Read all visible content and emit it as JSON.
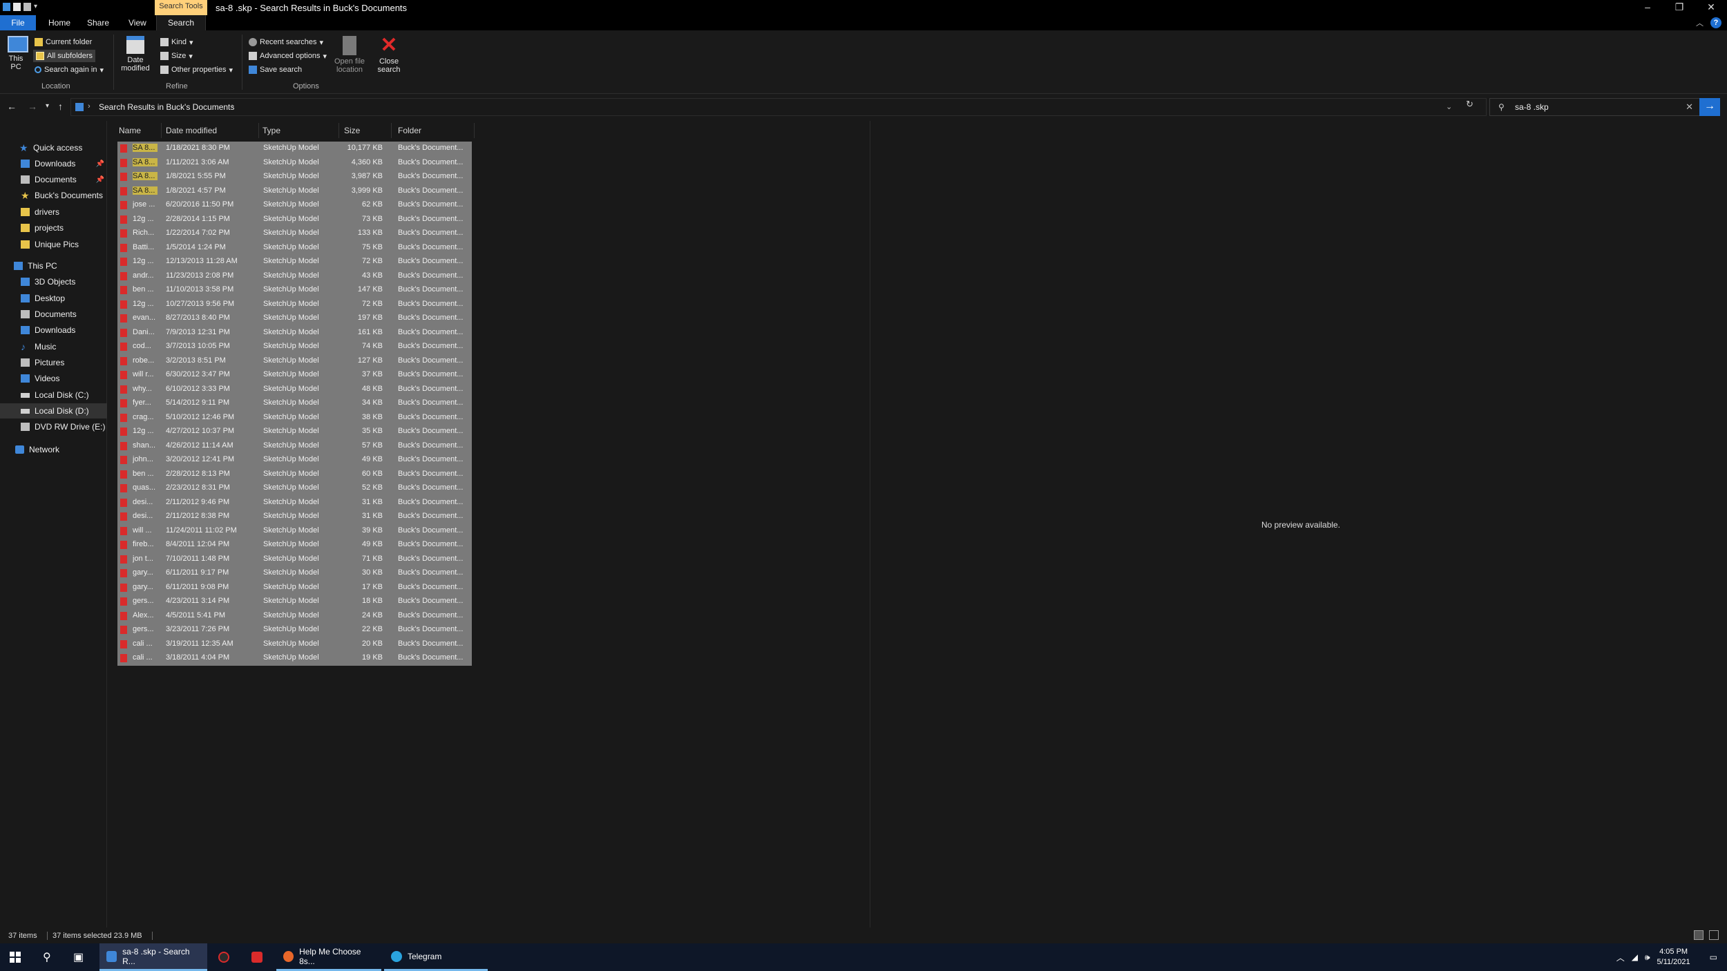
{
  "window": {
    "title": "sa-8 .skp - Search Results in Buck's Documents",
    "context_tab": "Search Tools"
  },
  "ribbon_tabs": [
    "File",
    "Home",
    "Share",
    "View",
    "Search"
  ],
  "ribbon": {
    "this_pc": "This PC",
    "current_folder": "Current folder",
    "all_subfolders": "All subfolders",
    "search_again_in": "Search again in",
    "location_label": "Location",
    "date_modified": "Date modified",
    "kind": "Kind",
    "size": "Size",
    "other_properties": "Other properties",
    "refine_label": "Refine",
    "recent_searches": "Recent searches",
    "advanced_options": "Advanced options",
    "save_search": "Save search",
    "open_file_location": "Open file location",
    "options_label": "Options",
    "close_search": "Close search"
  },
  "address": {
    "path": "Search Results in Buck's Documents",
    "search_value": "sa-8 .skp"
  },
  "nav": [
    {
      "label": "Quick access",
      "icon": "star-icon"
    },
    {
      "label": "Downloads",
      "icon": "download-icon",
      "pinned": true
    },
    {
      "label": "Documents",
      "icon": "documents-icon",
      "pinned": true
    },
    {
      "label": "Buck's Documents",
      "icon": "star-folder-icon"
    },
    {
      "label": "drivers",
      "icon": "folder-icon"
    },
    {
      "label": "projects",
      "icon": "folder-icon"
    },
    {
      "label": "Unique Pics",
      "icon": "folder-icon"
    },
    {
      "label": "This PC",
      "icon": "computer-icon"
    },
    {
      "label": "3D Objects",
      "icon": "cube-icon"
    },
    {
      "label": "Desktop",
      "icon": "desktop-icon"
    },
    {
      "label": "Documents",
      "icon": "documents-icon"
    },
    {
      "label": "Downloads",
      "icon": "download-icon"
    },
    {
      "label": "Music",
      "icon": "music-icon"
    },
    {
      "label": "Pictures",
      "icon": "pictures-icon"
    },
    {
      "label": "Videos",
      "icon": "videos-icon"
    },
    {
      "label": "Local Disk (C:)",
      "icon": "drive-icon"
    },
    {
      "label": "Local Disk (D:)",
      "icon": "drive-icon",
      "selected": true
    },
    {
      "label": "DVD RW Drive (E:) B",
      "icon": "dvd-icon"
    },
    {
      "label": "Network",
      "icon": "network-icon"
    }
  ],
  "columns": [
    "Name",
    "Date modified",
    "Type",
    "Size",
    "Folder"
  ],
  "files": [
    {
      "name": "SA 8...",
      "date": "1/18/2021 8:30 PM",
      "type": "SketchUp Model",
      "size": "10,177 KB",
      "folder": "Buck's Document...",
      "hl": true
    },
    {
      "name": "SA 8...",
      "date": "1/11/2021 3:06 AM",
      "type": "SketchUp Model",
      "size": "4,360 KB",
      "folder": "Buck's Document...",
      "hl": true
    },
    {
      "name": "SA 8...",
      "date": "1/8/2021 5:55 PM",
      "type": "SketchUp Model",
      "size": "3,987 KB",
      "folder": "Buck's Document...",
      "hl": true
    },
    {
      "name": "SA 8...",
      "date": "1/8/2021 4:57 PM",
      "type": "SketchUp Model",
      "size": "3,999 KB",
      "folder": "Buck's Document...",
      "hl": true
    },
    {
      "name": "jose ...",
      "date": "6/20/2016 11:50 PM",
      "type": "SketchUp Model",
      "size": "62 KB",
      "folder": "Buck's Document..."
    },
    {
      "name": "12g ...",
      "date": "2/28/2014 1:15 PM",
      "type": "SketchUp Model",
      "size": "73 KB",
      "folder": "Buck's Document..."
    },
    {
      "name": "Rich...",
      "date": "1/22/2014 7:02 PM",
      "type": "SketchUp Model",
      "size": "133 KB",
      "folder": "Buck's Document..."
    },
    {
      "name": "Batti...",
      "date": "1/5/2014 1:24 PM",
      "type": "SketchUp Model",
      "size": "75 KB",
      "folder": "Buck's Document..."
    },
    {
      "name": "12g ...",
      "date": "12/13/2013 11:28 AM",
      "type": "SketchUp Model",
      "size": "72 KB",
      "folder": "Buck's Document..."
    },
    {
      "name": "andr...",
      "date": "11/23/2013 2:08 PM",
      "type": "SketchUp Model",
      "size": "43 KB",
      "folder": "Buck's Document..."
    },
    {
      "name": "ben ...",
      "date": "11/10/2013 3:58 PM",
      "type": "SketchUp Model",
      "size": "147 KB",
      "folder": "Buck's Document..."
    },
    {
      "name": "12g ...",
      "date": "10/27/2013 9:56 PM",
      "type": "SketchUp Model",
      "size": "72 KB",
      "folder": "Buck's Document..."
    },
    {
      "name": "evan...",
      "date": "8/27/2013 8:40 PM",
      "type": "SketchUp Model",
      "size": "197 KB",
      "folder": "Buck's Document..."
    },
    {
      "name": "Dani...",
      "date": "7/9/2013 12:31 PM",
      "type": "SketchUp Model",
      "size": "161 KB",
      "folder": "Buck's Document..."
    },
    {
      "name": "cod...",
      "date": "3/7/2013 10:05 PM",
      "type": "SketchUp Model",
      "size": "74 KB",
      "folder": "Buck's Document..."
    },
    {
      "name": "robe...",
      "date": "3/2/2013 8:51 PM",
      "type": "SketchUp Model",
      "size": "127 KB",
      "folder": "Buck's Document..."
    },
    {
      "name": "will r...",
      "date": "6/30/2012 3:47 PM",
      "type": "SketchUp Model",
      "size": "37 KB",
      "folder": "Buck's Document..."
    },
    {
      "name": "why...",
      "date": "6/10/2012 3:33 PM",
      "type": "SketchUp Model",
      "size": "48 KB",
      "folder": "Buck's Document..."
    },
    {
      "name": "fyer...",
      "date": "5/14/2012 9:11 PM",
      "type": "SketchUp Model",
      "size": "34 KB",
      "folder": "Buck's Document..."
    },
    {
      "name": "crag...",
      "date": "5/10/2012 12:46 PM",
      "type": "SketchUp Model",
      "size": "38 KB",
      "folder": "Buck's Document..."
    },
    {
      "name": "12g ...",
      "date": "4/27/2012 10:37 PM",
      "type": "SketchUp Model",
      "size": "35 KB",
      "folder": "Buck's Document..."
    },
    {
      "name": "shan...",
      "date": "4/26/2012 11:14 AM",
      "type": "SketchUp Model",
      "size": "57 KB",
      "folder": "Buck's Document..."
    },
    {
      "name": "john...",
      "date": "3/20/2012 12:41 PM",
      "type": "SketchUp Model",
      "size": "49 KB",
      "folder": "Buck's Document..."
    },
    {
      "name": "ben ...",
      "date": "2/28/2012 8:13 PM",
      "type": "SketchUp Model",
      "size": "60 KB",
      "folder": "Buck's Document..."
    },
    {
      "name": "quas...",
      "date": "2/23/2012 8:31 PM",
      "type": "SketchUp Model",
      "size": "52 KB",
      "folder": "Buck's Document..."
    },
    {
      "name": "desi...",
      "date": "2/11/2012 9:46 PM",
      "type": "SketchUp Model",
      "size": "31 KB",
      "folder": "Buck's Document..."
    },
    {
      "name": "desi...",
      "date": "2/11/2012 8:38 PM",
      "type": "SketchUp Model",
      "size": "31 KB",
      "folder": "Buck's Document..."
    },
    {
      "name": "will ...",
      "date": "11/24/2011 11:02 PM",
      "type": "SketchUp Model",
      "size": "39 KB",
      "folder": "Buck's Document..."
    },
    {
      "name": "fireb...",
      "date": "8/4/2011 12:04 PM",
      "type": "SketchUp Model",
      "size": "49 KB",
      "folder": "Buck's Document..."
    },
    {
      "name": "jon t...",
      "date": "7/10/2011 1:48 PM",
      "type": "SketchUp Model",
      "size": "71 KB",
      "folder": "Buck's Document..."
    },
    {
      "name": "gary...",
      "date": "6/11/2011 9:17 PM",
      "type": "SketchUp Model",
      "size": "30 KB",
      "folder": "Buck's Document..."
    },
    {
      "name": "gary...",
      "date": "6/11/2011 9:08 PM",
      "type": "SketchUp Model",
      "size": "17 KB",
      "folder": "Buck's Document..."
    },
    {
      "name": "gers...",
      "date": "4/23/2011 3:14 PM",
      "type": "SketchUp Model",
      "size": "18 KB",
      "folder": "Buck's Document..."
    },
    {
      "name": "Alex...",
      "date": "4/5/2011 5:41 PM",
      "type": "SketchUp Model",
      "size": "24 KB",
      "folder": "Buck's Document..."
    },
    {
      "name": "gers...",
      "date": "3/23/2011 7:26 PM",
      "type": "SketchUp Model",
      "size": "22 KB",
      "folder": "Buck's Document..."
    },
    {
      "name": "cali ...",
      "date": "3/19/2011 12:35 AM",
      "type": "SketchUp Model",
      "size": "20 KB",
      "folder": "Buck's Document..."
    },
    {
      "name": "cali ...",
      "date": "3/18/2011 4:04 PM",
      "type": "SketchUp Model",
      "size": "19 KB",
      "folder": "Buck's Document..."
    }
  ],
  "preview": {
    "text": "No preview available."
  },
  "status": {
    "items": "37 items",
    "selected": "37 items selected 23.9 MB"
  },
  "taskbar": {
    "apps": [
      {
        "label": "sa-8 .skp - Search R...",
        "active": true
      },
      {
        "label": "Help Me Choose 8s..."
      },
      {
        "label": "Telegram"
      }
    ],
    "time": "4:05 PM",
    "date": "5/11/2021"
  },
  "colors": {
    "accent": "#1f6fd1",
    "selection": "#7a7a7a",
    "highlight": "#c9b547",
    "skp_icon": "#d92b2b"
  }
}
